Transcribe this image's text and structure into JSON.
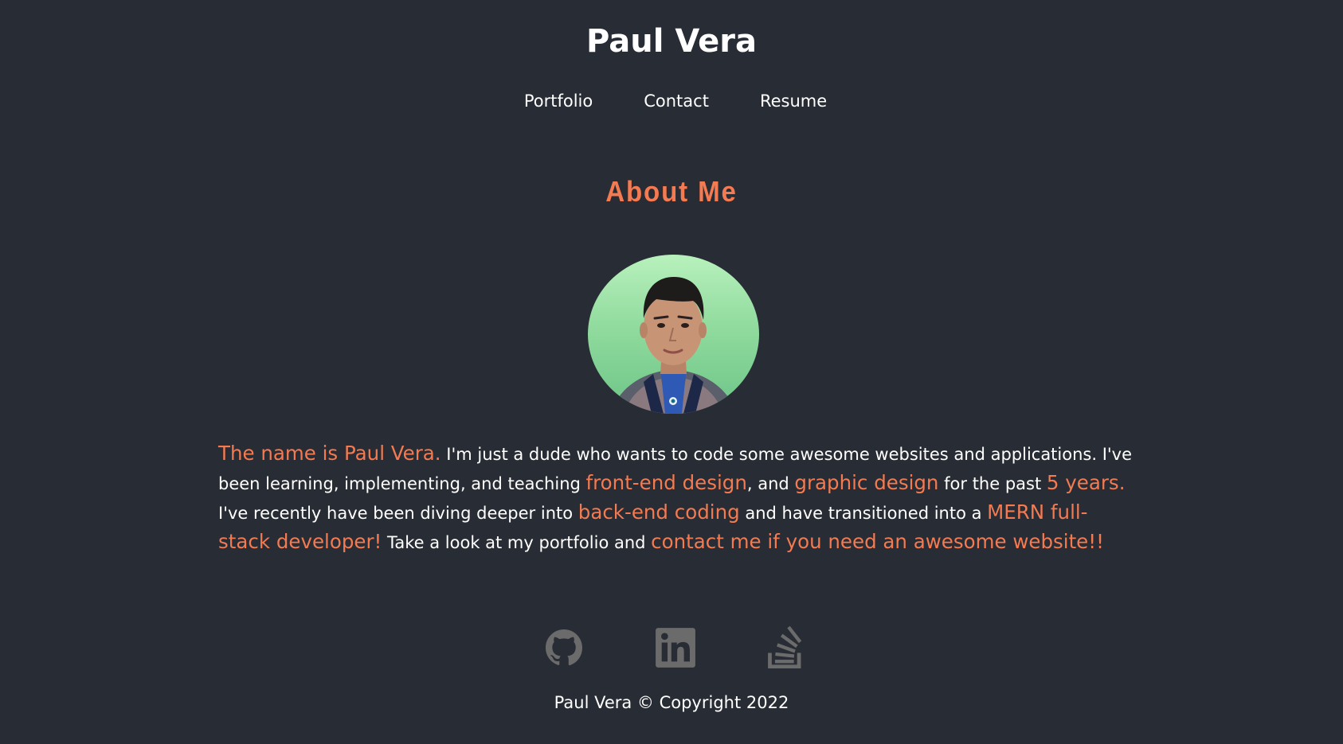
{
  "header": {
    "title": "Paul Vera",
    "nav": [
      {
        "label": "Portfolio"
      },
      {
        "label": "Contact"
      },
      {
        "label": "Resume"
      }
    ]
  },
  "about": {
    "title": "About Me",
    "bio": [
      {
        "text": "The name is Paul Vera.",
        "highlight": true
      },
      {
        "text": " I'm just a dude who wants to code some awesome websites and applications. I've been learning, implementing, and teaching ",
        "highlight": false
      },
      {
        "text": "front-end design",
        "highlight": true
      },
      {
        "text": ", and ",
        "highlight": false
      },
      {
        "text": "graphic design",
        "highlight": true
      },
      {
        "text": " for the past ",
        "highlight": false
      },
      {
        "text": "5 years.",
        "highlight": true
      },
      {
        "text": " I've recently have been diving deeper into ",
        "highlight": false
      },
      {
        "text": "back-end coding",
        "highlight": true
      },
      {
        "text": " and have transitioned into a ",
        "highlight": false
      },
      {
        "text": "MERN full-stack developer!",
        "highlight": true
      },
      {
        "text": " Take a look at my portfolio and ",
        "highlight": false
      },
      {
        "text": "contact me if you need an awesome website!!",
        "highlight": true
      }
    ]
  },
  "footer": {
    "socials": [
      {
        "icon": "github-icon"
      },
      {
        "icon": "linkedin-icon"
      },
      {
        "icon": "stackoverflow-icon"
      }
    ],
    "copyright": "Paul Vera © Copyright 2022"
  },
  "colors": {
    "background": "#282c34",
    "accent": "#f37a51",
    "text": "#ffffff",
    "icon": "#6b6b6b"
  }
}
